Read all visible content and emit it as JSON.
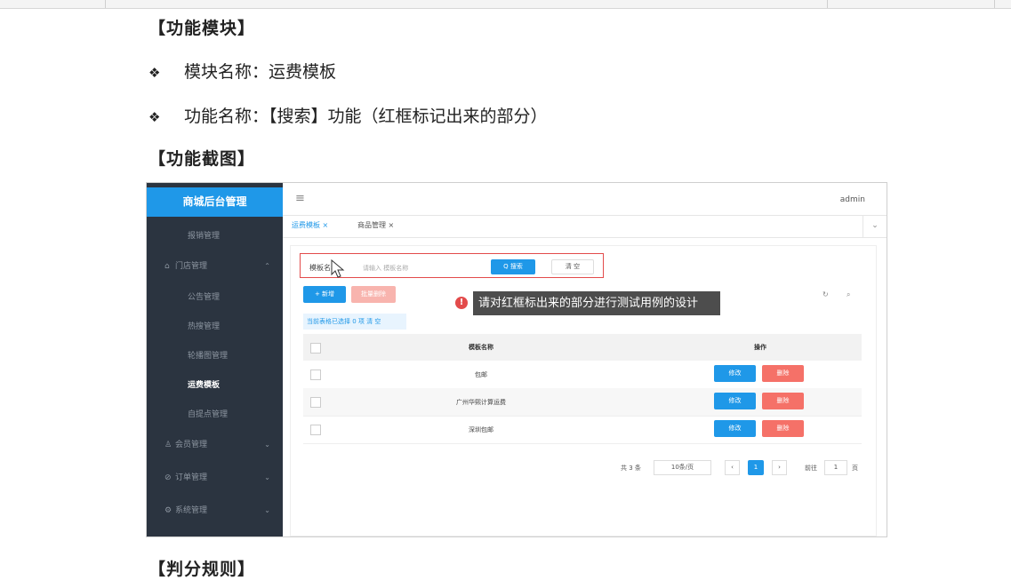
{
  "doc": {
    "heading1": "【功能模块】",
    "bullet_icon": "❖",
    "bullet1_label": "模块名称：",
    "bullet1_value": "运费模板",
    "bullet2_label": "功能名称：",
    "bullet2_value": "【搜索】功能（红框标记出来的部分）",
    "heading2": "【功能截图】",
    "heading3": "【判分规则】"
  },
  "app": {
    "brand": "商城后台管理",
    "user": "admin",
    "menu": [
      {
        "label": "报销管理",
        "type": "sub"
      },
      {
        "label": "门店管理",
        "type": "group",
        "icon": "store-icon"
      },
      {
        "label": "公告管理",
        "type": "sub"
      },
      {
        "label": "热搜管理",
        "type": "sub"
      },
      {
        "label": "轮播图管理",
        "type": "sub"
      },
      {
        "label": "运费模板",
        "type": "sub",
        "active": true
      },
      {
        "label": "自提点管理",
        "type": "sub"
      },
      {
        "label": "会员管理",
        "type": "group",
        "icon": "user-icon"
      },
      {
        "label": "订单管理",
        "type": "group",
        "icon": "order-icon"
      },
      {
        "label": "系统管理",
        "type": "group",
        "icon": "settings-icon"
      }
    ],
    "tabs": [
      {
        "label": "运费模板 ×",
        "active": true
      },
      {
        "label": "商品管理 ×",
        "active": false
      }
    ],
    "search": {
      "label": "模板名称:",
      "placeholder": "请输入 模板名称",
      "search_button": "Q 搜索",
      "clear_button": "清 空"
    },
    "actions": {
      "add": "+ 新增",
      "batch_delete": "批量删除"
    },
    "tooltip": "请对红框标出来的部分进行测试用例的设计",
    "selection_info": "当前表格已选择 0 项  清 空",
    "table": {
      "col_name": "模板名称",
      "col_ops": "操作",
      "rows": [
        "包邮",
        "广州华熙计算运费",
        "深圳包邮"
      ],
      "edit": "修改",
      "delete": "删除"
    },
    "pager": {
      "total": "共 3 条",
      "size": "10条/页",
      "current_page": "1",
      "goto_label": "前往",
      "goto_value": "1",
      "page_unit": "页"
    },
    "colors": {
      "accent": "#1f98e8",
      "danger": "#f57168",
      "sidebar": "#2b3440",
      "highlight": "#e34b4b"
    }
  }
}
